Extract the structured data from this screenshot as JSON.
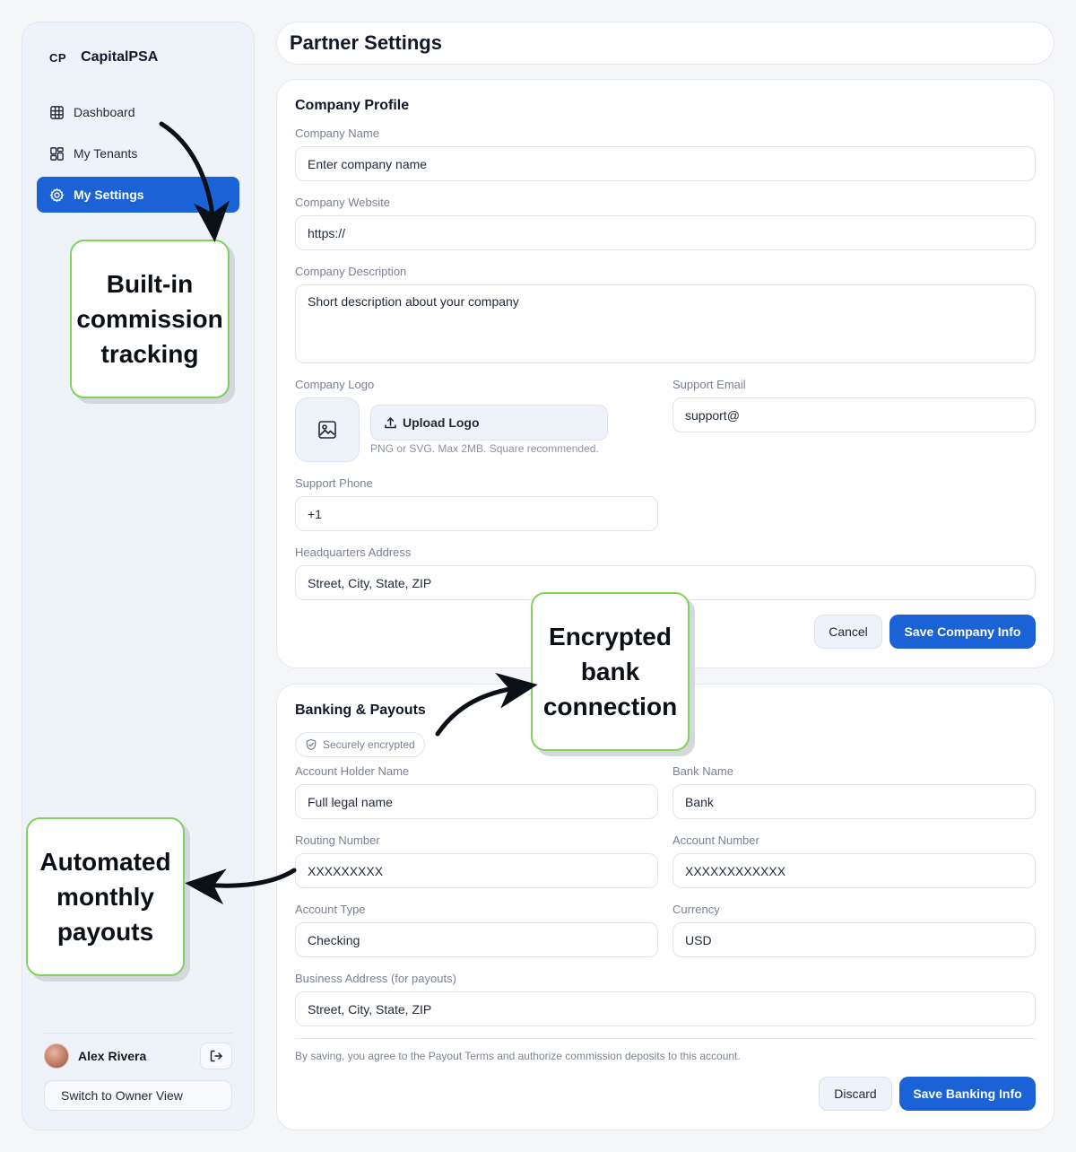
{
  "sidebar": {
    "brand_mark": "CP",
    "brand_name": "CapitalPSA",
    "nav": [
      {
        "label": "Dashboard",
        "icon": "grid-icon"
      },
      {
        "label": "My Tenants",
        "icon": "tenants-icon"
      },
      {
        "label": "My Settings",
        "icon": "gear-icon",
        "active": true
      }
    ],
    "user": {
      "name": "Alex Rivera"
    },
    "switch_label": "Switch to Owner View"
  },
  "header": {
    "title": "Partner Settings"
  },
  "company": {
    "title": "Company Profile",
    "name_label": "Company Name",
    "name_placeholder": "Enter company name",
    "website_label": "Company Website",
    "website_value": "https://",
    "description_label": "Company Description",
    "description_placeholder": "Short description about your company",
    "logo_label": "Company Logo",
    "upload_label": "Upload Logo",
    "upload_hint": "PNG or SVG. Max 2MB. Square recommended.",
    "support_email_label": "Support Email",
    "support_email_value": "support@",
    "support_phone_label": "Support Phone",
    "support_phone_value": "+1",
    "hq_label": "Headquarters Address",
    "hq_placeholder": "Street, City, State, ZIP",
    "cancel_label": "Cancel",
    "save_label": "Save Company Info"
  },
  "banking": {
    "title": "Banking & Payouts",
    "badge": "Securely encrypted",
    "holder_label": "Account Holder Name",
    "holder_placeholder": "Full legal name",
    "bank_label": "Bank Name",
    "bank_placeholder": "Bank",
    "routing_label": "Routing Number",
    "routing_value": "XXXXXXXXX",
    "account_label": "Account Number",
    "account_value": "XXXXXXXXXXXX",
    "type_label": "Account Type",
    "type_value": "Checking",
    "currency_label": "Currency",
    "currency_value": "USD",
    "address_label": "Business Address (for payouts)",
    "address_placeholder": "Street, City, State, ZIP",
    "terms": "By saving, you agree to the Payout Terms and authorize commission deposits to this account.",
    "discard_label": "Discard",
    "save_label": "Save Banking Info"
  },
  "callouts": {
    "commission": [
      "Built-in",
      "commission",
      "tracking"
    ],
    "encrypted": [
      "Encrypted",
      "bank",
      "connection"
    ],
    "payouts": [
      "Automated",
      "monthly",
      "payouts"
    ]
  },
  "colors": {
    "accent": "#1a62d6",
    "callout_border": "#7dd35c"
  }
}
